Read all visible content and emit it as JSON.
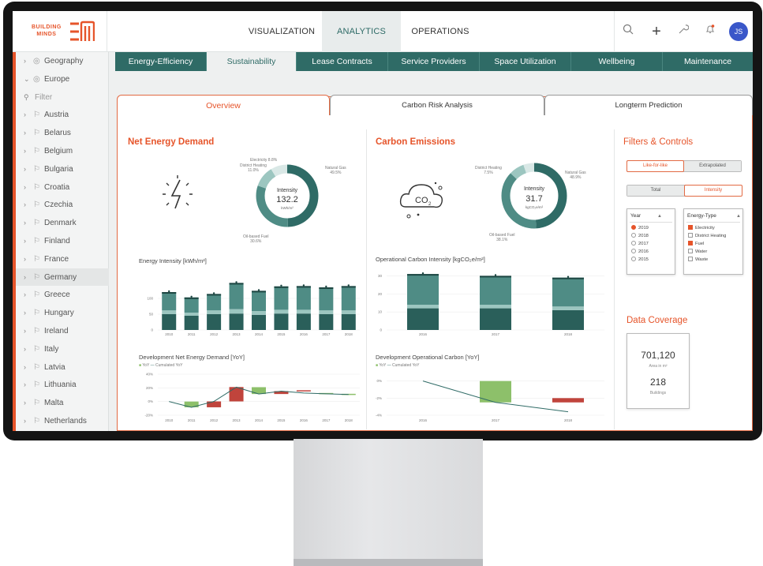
{
  "logo": {
    "line1": "BUILDING",
    "line2": "MINDS"
  },
  "nav": {
    "tabs": [
      "VISUALIZATION",
      "ANALYTICS",
      "OPERATIONS"
    ],
    "active": "ANALYTICS"
  },
  "user": {
    "initials": "JS"
  },
  "sidebar": {
    "geography": "Geography",
    "europe": "Europe",
    "filter_placeholder": "Filter",
    "countries": [
      "Austria",
      "Belarus",
      "Belgium",
      "Bulgaria",
      "Croatia",
      "Czechia",
      "Denmark",
      "Finland",
      "France",
      "Germany",
      "Greece",
      "Hungary",
      "Ireland",
      "Italy",
      "Latvia",
      "Lithuania",
      "Malta",
      "Netherlands"
    ],
    "selected": "Germany"
  },
  "subnav": {
    "tabs": [
      "Energy-Efficiency",
      "Sustainability",
      "Lease Contracts",
      "Service Providers",
      "Space Utilization",
      "Wellbeing",
      "Maintenance"
    ],
    "active": "Sustainability"
  },
  "panel_tabs": {
    "tabs": [
      "Overview",
      "Carbon Risk Analysis",
      "Longterm Prediction"
    ],
    "active": "Overview"
  },
  "energy": {
    "title": "Net Energy Demand",
    "donut": {
      "center_label": "Intensity",
      "center_value": "132.2",
      "center_unit": "kWh/m²",
      "labels": {
        "electricity": "Electricity 8.8%",
        "district": "District Heating",
        "district_pct": "11.0%",
        "gas": "Natural Gas",
        "gas_pct": "49.5%",
        "oil": "Oil-based Fuel",
        "oil_pct": "30.6%"
      },
      "slices": [
        49.5,
        30.6,
        11.0,
        8.8
      ]
    },
    "bar_title": "Energy Intensity [kWh/m²]",
    "line_title": "Development Net Energy Demand [YoY]",
    "legend_yoy": "YoY",
    "legend_cum": "Cumulated YoY"
  },
  "carbon": {
    "title": "Carbon Emissions",
    "donut": {
      "center_label": "Intensity",
      "center_value": "31.7",
      "center_unit": "kgCO₂e/m²",
      "labels": {
        "district": "District Heating",
        "district_pct": "7.5%",
        "gas": "Natural Gas",
        "gas_pct": "48.9%",
        "oil": "Oil-based Fuel",
        "oil_pct": "38.1%"
      },
      "slices": [
        48.9,
        38.1,
        7.5,
        5.5
      ]
    },
    "bar_title": "Operational Carbon Intensity [kgCO₂e/m²]",
    "line_title": "Development Operational Carbon [YoY]",
    "legend_yoy": "YoY",
    "legend_cum": "Cumulated YoY"
  },
  "filters": {
    "title": "Filters & Controls",
    "toggle1": [
      "Like-for-like",
      "Extrapolated"
    ],
    "toggle2": [
      "Total",
      "Intensity"
    ],
    "year_header": "Year",
    "years": [
      "2019",
      "2018",
      "2017",
      "2016",
      "2015"
    ],
    "year_selected": "2019",
    "energy_header": "Energy-Type",
    "energy_types": [
      "Electricity",
      "District Heating",
      "Fuel",
      "Water",
      "Waste"
    ],
    "energy_checked": [
      "Electricity",
      "Fuel"
    ]
  },
  "coverage": {
    "title": "Data Coverage",
    "area": "701,120",
    "area_label": "Area in m²",
    "buildings": "218",
    "buildings_label": "Buildings"
  },
  "colors": {
    "accent": "#e6542a",
    "teal_dark": "#2f6b66",
    "teal_mid": "#4f8c85",
    "teal_light": "#9cc6c0",
    "red": "#c0443c",
    "green": "#8dc06a"
  },
  "chart_data": [
    {
      "type": "bar",
      "title": "Energy Intensity [kWh/m²]",
      "categories": [
        "2010",
        "2011",
        "2012",
        "2013",
        "2014",
        "2015",
        "2016",
        "2017",
        "2018"
      ],
      "yticks": [
        "0",
        "50",
        "100"
      ],
      "ylim": [
        0,
        150
      ],
      "series": [
        {
          "values": [
            50,
            45,
            50,
            52,
            48,
            52,
            52,
            50,
            50
          ]
        },
        {
          "values": [
            12,
            10,
            12,
            14,
            12,
            12,
            12,
            12,
            12
          ]
        },
        {
          "values": [
            58,
            48,
            52,
            83,
            64,
            74,
            75,
            73,
            77
          ]
        }
      ]
    },
    {
      "type": "bar",
      "title": "Operational Carbon Intensity [kgCO₂e/m²]",
      "categories": [
        "2016",
        "2017",
        "2018"
      ],
      "yticks": [
        "0",
        "10",
        "20",
        "30"
      ],
      "ylim": [
        0,
        35
      ],
      "series": [
        {
          "values": [
            12,
            12,
            11
          ]
        },
        {
          "values": [
            2,
            2,
            2
          ]
        },
        {
          "values": [
            17,
            16,
            16
          ]
        }
      ]
    },
    {
      "type": "bar",
      "title": "Development Net Energy Demand [YoY]",
      "categories": [
        "2010",
        "2011",
        "2012",
        "2013",
        "2014",
        "2015",
        "2016",
        "2017",
        "2018"
      ],
      "yticks": [
        "-20%",
        "0%",
        "20%",
        "40%"
      ],
      "ylim": [
        -20,
        40
      ],
      "series": [
        {
          "name": "YoY",
          "values": [
            0,
            -8.4,
            8.6,
            21,
            -10,
            4.2,
            1.3,
            -1.2,
            -1
          ]
        },
        {
          "name": "Cumulated YoY",
          "values": [
            0,
            -8.4,
            0.2,
            21,
            11,
            15.2,
            12.5,
            11.3,
            10.3
          ]
        }
      ]
    },
    {
      "type": "bar",
      "title": "Development Operational Carbon [YoY]",
      "categories": [
        "2016",
        "2017",
        "2018"
      ],
      "yticks": [
        "-4%",
        "-2%",
        "0%"
      ],
      "ylim": [
        -4,
        0.8
      ],
      "series": [
        {
          "name": "YoY",
          "values": [
            0,
            -2.5,
            0.5
          ]
        },
        {
          "name": "Cumulated YoY",
          "values": [
            0,
            -2.5,
            -3.6
          ]
        }
      ]
    }
  ]
}
